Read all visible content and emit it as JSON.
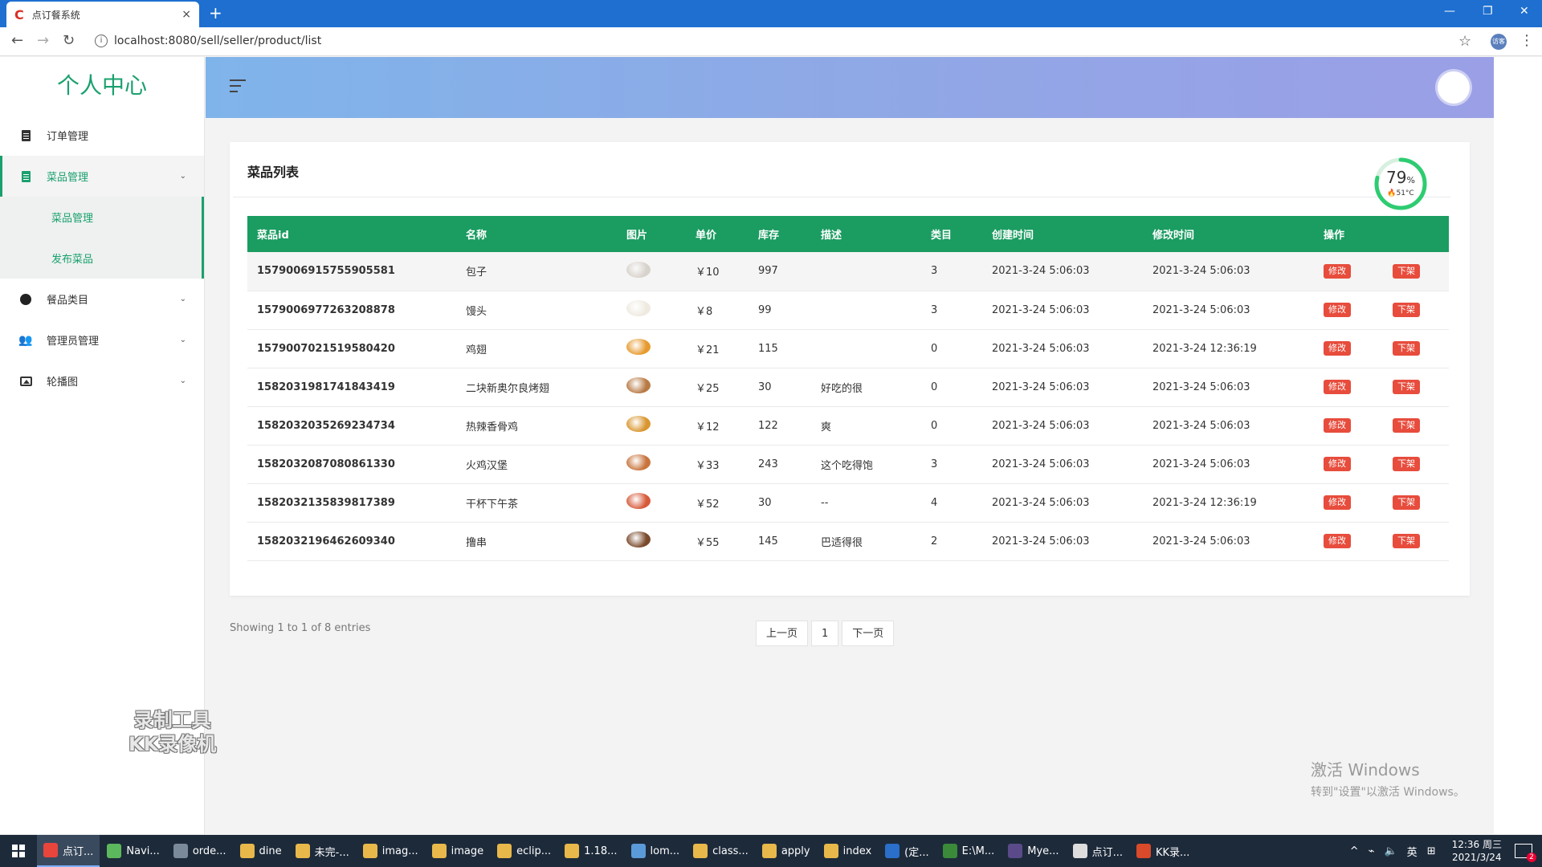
{
  "browser": {
    "tab_title": "点订餐系统",
    "tab_favicon": "C",
    "close_glyph": "×",
    "new_tab_glyph": "+",
    "url": "localhost:8080/sell/seller/product/list",
    "profile_label": "访客"
  },
  "sidebar": {
    "brand": "个人中心",
    "items": [
      {
        "label": "订单管理",
        "icon": "document-icon"
      },
      {
        "label": "菜品管理",
        "icon": "document-icon",
        "active": true
      },
      {
        "label": "餐品类目",
        "icon": "circle-icon"
      },
      {
        "label": "管理员管理",
        "icon": "users-icon"
      },
      {
        "label": "轮播图",
        "icon": "image-icon"
      }
    ],
    "subitems": [
      {
        "label": "菜品管理"
      },
      {
        "label": "发布菜品"
      }
    ],
    "watermark_line1": "录制工具",
    "watermark_line2": "KK录像机"
  },
  "card": {
    "title": "菜品列表",
    "gauge_percent": "79",
    "gauge_percent_unit": "%",
    "gauge_temp": "51°C",
    "gauge_value": 0.79
  },
  "table": {
    "headers": [
      "菜品id",
      "名称",
      "图片",
      "单价",
      "库存",
      "描述",
      "类目",
      "创建时间",
      "修改时间",
      "操作"
    ],
    "edit_label": "修改",
    "offline_label": "下架",
    "rows": [
      {
        "id": "1579006915755905581",
        "name": "包子",
        "price": "￥10",
        "stock": "997",
        "desc": "",
        "category": "3",
        "created": "2021-3-24 5:06:03",
        "modified": "2021-3-24 5:06:03",
        "img_color": "#d8d2cc"
      },
      {
        "id": "1579006977263208878",
        "name": "馒头",
        "price": "￥8",
        "stock": "99",
        "desc": "",
        "category": "3",
        "created": "2021-3-24 5:06:03",
        "modified": "2021-3-24 5:06:03",
        "img_color": "#efeae0"
      },
      {
        "id": "1579007021519580420",
        "name": "鸡翅",
        "price": "￥21",
        "stock": "115",
        "desc": "",
        "category": "0",
        "created": "2021-3-24 5:06:03",
        "modified": "2021-3-24 12:36:19",
        "img_color": "#e69a2e"
      },
      {
        "id": "1582031981741843419",
        "name": "二块新奥尔良烤翅",
        "price": "￥25",
        "stock": "30",
        "desc": "好吃的很",
        "category": "0",
        "created": "2021-3-24 5:06:03",
        "modified": "2021-3-24 5:06:03",
        "img_color": "#b87a44"
      },
      {
        "id": "1582032035269234734",
        "name": "热辣香骨鸡",
        "price": "￥12",
        "stock": "122",
        "desc": "爽",
        "category": "0",
        "created": "2021-3-24 5:06:03",
        "modified": "2021-3-24 5:06:03",
        "img_color": "#d9962f"
      },
      {
        "id": "1582032087080861330",
        "name": "火鸡汉堡",
        "price": "￥33",
        "stock": "243",
        "desc": "这个吃得饱",
        "category": "3",
        "created": "2021-3-24 5:06:03",
        "modified": "2021-3-24 5:06:03",
        "img_color": "#c8743c"
      },
      {
        "id": "1582032135839817389",
        "name": "干杯下午茶",
        "price": "￥52",
        "stock": "30",
        "desc": "--",
        "category": "4",
        "created": "2021-3-24 5:06:03",
        "modified": "2021-3-24 12:36:19",
        "img_color": "#d65a3a"
      },
      {
        "id": "1582032196462609340",
        "name": "撸串",
        "price": "￥55",
        "stock": "145",
        "desc": "巴适得很",
        "category": "2",
        "created": "2021-3-24 5:06:03",
        "modified": "2021-3-24 5:06:03",
        "img_color": "#7a4a2c"
      }
    ]
  },
  "pagination": {
    "showing": "Showing 1 to 1 of 8 entries",
    "prev": "上一页",
    "page": "1",
    "next": "下一页"
  },
  "windows_activation": {
    "line1": "激活 Windows",
    "line2": "转到\"设置\"以激活 Windows。"
  },
  "taskbar": {
    "items": [
      {
        "label": "点订...",
        "color": "#e8453c",
        "active": true
      },
      {
        "label": "Navi...",
        "color": "#5cb85c"
      },
      {
        "label": "orde...",
        "color": "#7a8a9a"
      },
      {
        "label": "dine",
        "color": "#e8b84a"
      },
      {
        "label": "未完-...",
        "color": "#e8b84a"
      },
      {
        "label": "imag...",
        "color": "#e8b84a"
      },
      {
        "label": "image",
        "color": "#e8b84a"
      },
      {
        "label": "eclip...",
        "color": "#e8b84a"
      },
      {
        "label": "1.18...",
        "color": "#e8b84a"
      },
      {
        "label": "lom...",
        "color": "#5a9ad8"
      },
      {
        "label": "class...",
        "color": "#e8b84a"
      },
      {
        "label": "apply",
        "color": "#e8b84a"
      },
      {
        "label": "index",
        "color": "#e8b84a"
      },
      {
        "label": "(定...",
        "color": "#2a6fc9"
      },
      {
        "label": "E:\\M...",
        "color": "#3a8a3a"
      },
      {
        "label": "Mye...",
        "color": "#5a4a8a"
      },
      {
        "label": "点订...",
        "color": "#ddd"
      },
      {
        "label": "KK录...",
        "color": "#d84a2a"
      }
    ],
    "ime": "英",
    "time": "12:36 周三",
    "date": "2021/3/24",
    "notification_count": "2"
  }
}
